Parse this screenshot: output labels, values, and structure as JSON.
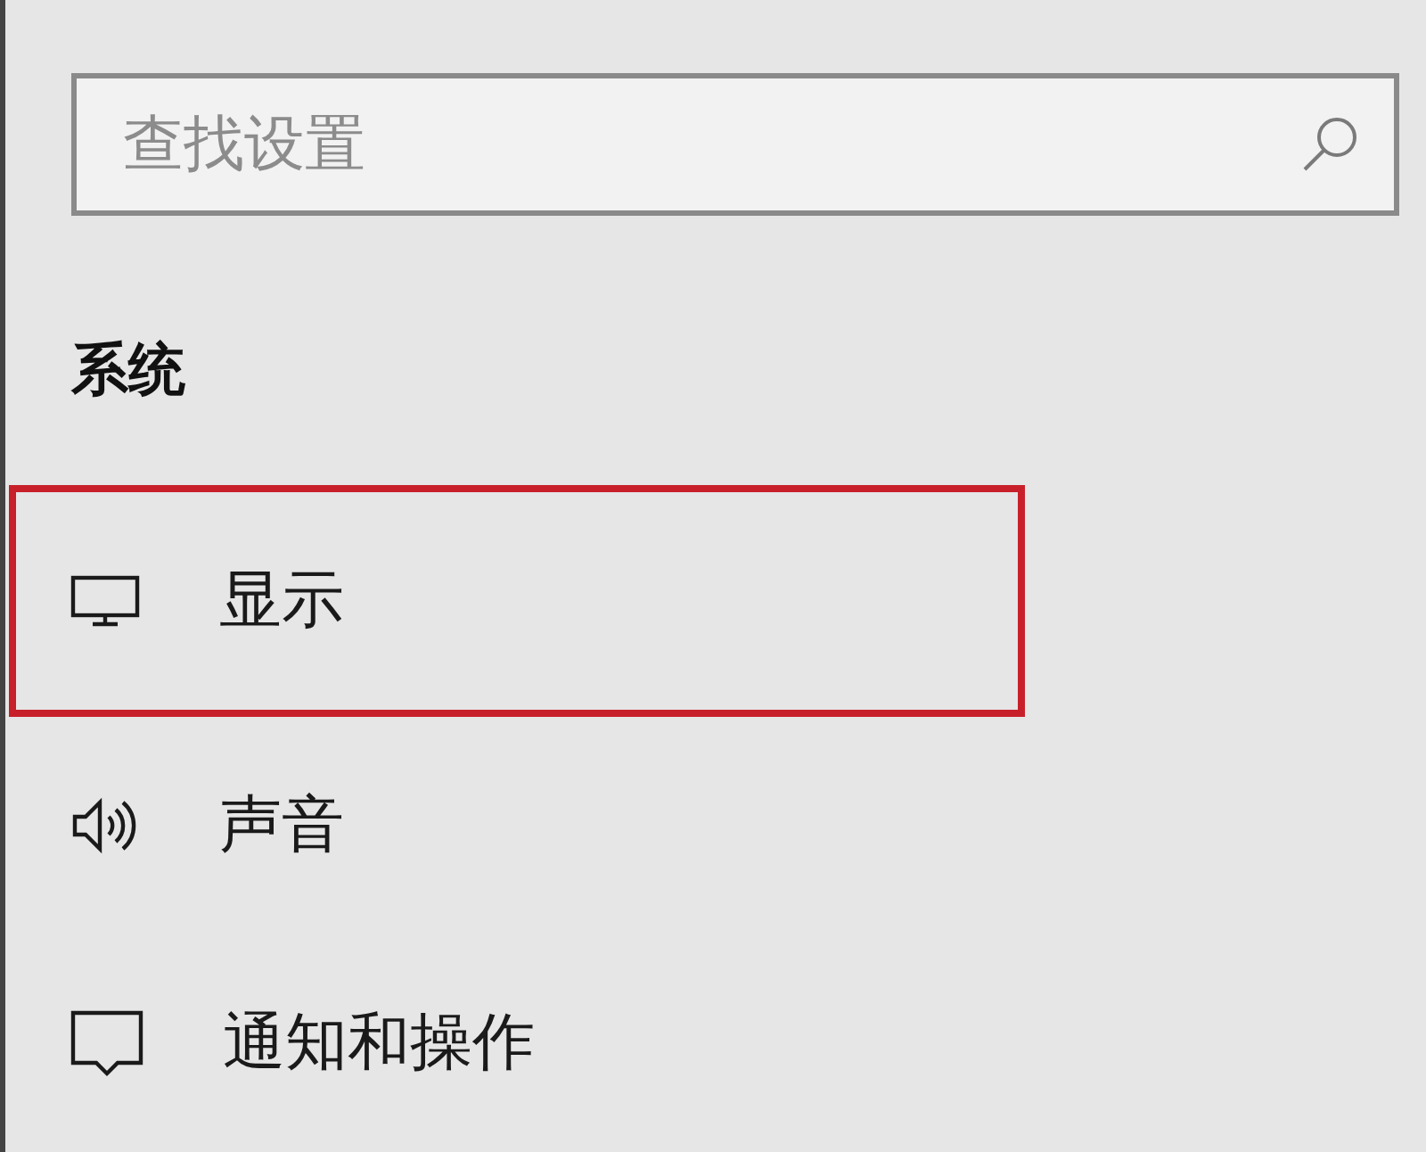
{
  "search": {
    "placeholder": "查找设置"
  },
  "section": {
    "title": "系统"
  },
  "items": [
    {
      "kind": "display",
      "label": "显示",
      "highlighted": true
    },
    {
      "kind": "sound",
      "label": "声音",
      "highlighted": false
    },
    {
      "kind": "notifications",
      "label": "通知和操作",
      "highlighted": false
    }
  ]
}
